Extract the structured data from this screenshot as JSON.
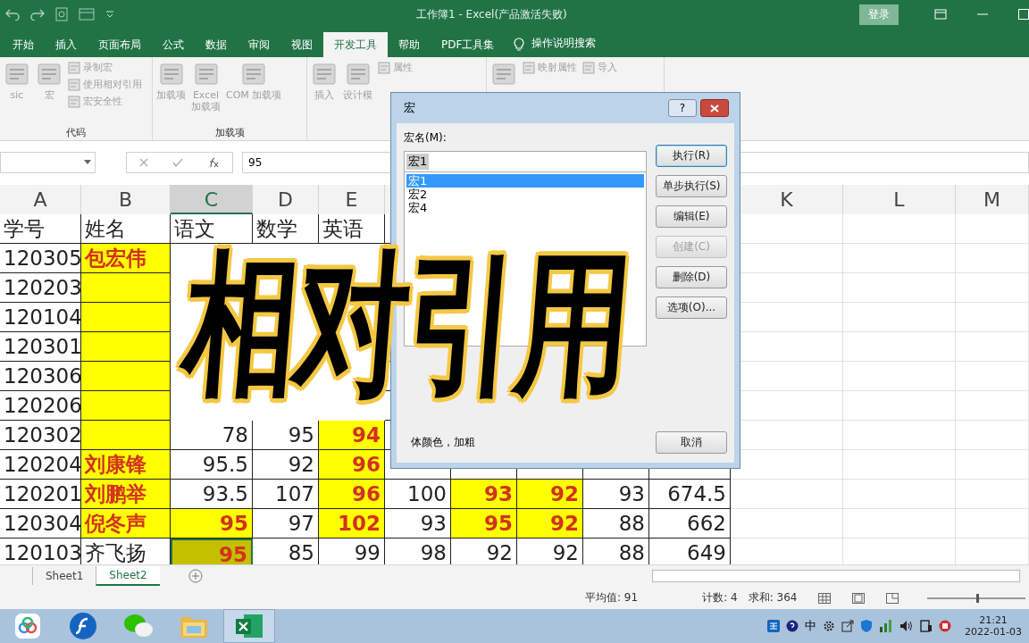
{
  "window": {
    "title": "工作簿1  -  Excel(产品激活失败)",
    "login": "登录"
  },
  "ribbon_tabs": [
    {
      "label": "开始",
      "selected": false
    },
    {
      "label": "插入",
      "selected": false
    },
    {
      "label": "页面布局",
      "selected": false
    },
    {
      "label": "公式",
      "selected": false
    },
    {
      "label": "数据",
      "selected": false
    },
    {
      "label": "审阅",
      "selected": false
    },
    {
      "label": "视图",
      "selected": false
    },
    {
      "label": "开发工具",
      "selected": true
    },
    {
      "label": "帮助",
      "selected": false
    },
    {
      "label": "PDF工具集",
      "selected": false
    }
  ],
  "tell_me": "操作说明搜索",
  "ribbon_groups": [
    {
      "label": "代码",
      "items": [
        {
          "label": "sic",
          "kind": "large"
        },
        {
          "label": "宏",
          "kind": "large"
        },
        {
          "kind": "stack",
          "items": [
            "录制宏",
            "使用相对引用",
            "宏安全性"
          ]
        }
      ]
    },
    {
      "label": "加载项",
      "items": [
        {
          "label": "加载项",
          "kind": "large"
        },
        {
          "label": "Excel\n加载项",
          "kind": "large"
        },
        {
          "label": "COM 加载项",
          "kind": "large"
        }
      ]
    },
    {
      "items": [
        {
          "label": "插入",
          "kind": "large"
        },
        {
          "label": "设计模",
          "kind": "large"
        },
        {
          "kind": "stack",
          "items": [
            "属性"
          ]
        }
      ]
    },
    {
      "items": [
        {
          "kind": "large"
        },
        {
          "kind": "stack",
          "items": [
            "映射属性"
          ]
        },
        {
          "kind": "stack",
          "items": [
            "导入"
          ]
        }
      ]
    }
  ],
  "formula_bar": {
    "value": "95"
  },
  "sheet": {
    "columns": [
      {
        "label": "A",
        "selected": false
      },
      {
        "label": "B",
        "selected": false
      },
      {
        "label": "C",
        "selected": true
      },
      {
        "label": "D",
        "selected": false
      },
      {
        "label": "E",
        "selected": false
      },
      null,
      null,
      null,
      null,
      null,
      {
        "label": "K",
        "selected": false
      },
      {
        "label": "L",
        "selected": false
      },
      {
        "label": "M",
        "selected": false
      }
    ],
    "rows": [
      {
        "cells": [
          {
            "text": "学号",
            "kind": "plain"
          },
          {
            "text": "姓名",
            "kind": "plain"
          },
          {
            "text": "语文",
            "kind": "plain"
          },
          {
            "text": "数学",
            "kind": "plain"
          },
          {
            "text": "英语",
            "kind": "plain"
          }
        ]
      },
      {
        "cells": [
          {
            "text": "120305",
            "kind": "plain"
          },
          {
            "text": "包宏伟",
            "kind": "highlight"
          }
        ]
      },
      {
        "cells": [
          {
            "text": "120203",
            "kind": "plain"
          },
          {
            "kind": "highlight"
          }
        ]
      },
      {
        "cells": [
          {
            "text": "120104",
            "kind": "plain"
          },
          {
            "kind": "highlight"
          }
        ]
      },
      {
        "cells": [
          {
            "text": "120301",
            "kind": "plain"
          },
          {
            "kind": "highlight"
          }
        ]
      },
      {
        "cells": [
          {
            "text": "120306",
            "kind": "plain"
          },
          {
            "kind": "highlight"
          }
        ]
      },
      {
        "cells": [
          {
            "text": "120206",
            "kind": "plain"
          },
          {
            "kind": "highlight"
          }
        ]
      },
      {
        "cells": [
          {
            "text": "120302",
            "kind": "plain"
          },
          {
            "kind": "highlight"
          },
          {
            "text": "78",
            "kind": "plain"
          },
          {
            "text": "95",
            "kind": "plain"
          },
          {
            "text": "94",
            "kind": "highlight"
          }
        ]
      },
      {
        "cells": [
          {
            "text": "120204",
            "kind": "plain"
          },
          {
            "text": "刘康锋",
            "kind": "highlight"
          },
          {
            "text": "95.5",
            "kind": "plain"
          },
          {
            "text": "92",
            "kind": "plain"
          },
          {
            "text": "96",
            "kind": "highlight"
          }
        ]
      },
      {
        "cells": [
          {
            "text": "120201",
            "kind": "plain"
          },
          {
            "text": "刘鹏举",
            "kind": "highlight"
          },
          {
            "text": "93.5",
            "kind": "plain"
          },
          {
            "text": "107",
            "kind": "plain"
          },
          {
            "text": "96",
            "kind": "highlight"
          },
          {
            "text": "100",
            "kind": "plain"
          },
          {
            "text": "93",
            "kind": "highlight"
          },
          {
            "text": "92",
            "kind": "highlight"
          },
          {
            "text": "93",
            "kind": "plain"
          },
          {
            "text": "674.5",
            "kind": "plain"
          }
        ]
      },
      {
        "cells": [
          {
            "text": "120304",
            "kind": "plain"
          },
          {
            "text": "倪冬声",
            "kind": "highlight"
          },
          {
            "text": "95",
            "kind": "highlight"
          },
          {
            "text": "97",
            "kind": "plain"
          },
          {
            "text": "102",
            "kind": "highlight"
          },
          {
            "text": "93",
            "kind": "plain"
          },
          {
            "text": "95",
            "kind": "highlight"
          },
          {
            "text": "92",
            "kind": "highlight"
          },
          {
            "text": "88",
            "kind": "plain"
          },
          {
            "text": "662",
            "kind": "plain"
          }
        ]
      },
      {
        "cells": [
          {
            "text": "120103",
            "kind": "plain"
          },
          {
            "text": "齐飞扬",
            "kind": "plain"
          },
          {
            "text": "95",
            "kind": "active"
          },
          {
            "text": "85",
            "kind": "plain"
          },
          {
            "text": "99",
            "kind": "plain"
          },
          {
            "text": "98",
            "kind": "plain"
          },
          {
            "text": "92",
            "kind": "plain"
          },
          {
            "text": "92",
            "kind": "plain"
          },
          {
            "text": "88",
            "kind": "plain"
          },
          {
            "text": "649",
            "kind": "plain"
          }
        ]
      }
    ]
  },
  "sheet_tabs": [
    {
      "label": "Sheet1",
      "selected": false
    },
    {
      "label": "Sheet2",
      "selected": true
    }
  ],
  "status_bar": {
    "average": "平均值: 91",
    "count": "计数: 4",
    "sum": "求和: 364",
    "zoom": {
      "level": 0.5
    }
  },
  "dialog": {
    "title": "宏",
    "help": "?",
    "name_label": "宏名(M):",
    "name_value": "宏1",
    "macros": [
      {
        "label": "宏1",
        "selected": true
      },
      {
        "label": "宏2",
        "selected": false
      },
      {
        "label": "宏4",
        "selected": false
      }
    ],
    "buttons": [
      {
        "label": "执行(R)",
        "kind": "default",
        "disabled": false
      },
      {
        "label": "单步执行(S)",
        "kind": "normal",
        "disabled": false
      },
      {
        "label": "编辑(E)",
        "kind": "normal",
        "disabled": false
      },
      {
        "label": "创建(C)",
        "kind": "normal",
        "disabled": true
      },
      {
        "label": "删除(D)",
        "kind": "normal",
        "disabled": false
      },
      {
        "label": "选项(O)...",
        "kind": "normal",
        "disabled": false
      }
    ],
    "description": "体颜色，加粗",
    "cancel": "取消"
  },
  "overlay_title": "相对引用",
  "taskbar": {
    "apps": [
      {
        "kind": "cloud",
        "selected": false
      },
      {
        "kind": "flash",
        "selected": false
      },
      {
        "kind": "chat",
        "selected": false
      },
      {
        "kind": "folder",
        "selected": false
      },
      {
        "kind": "excel",
        "selected": true
      }
    ],
    "ime": "中",
    "time": "21:21",
    "date": "2022-01-03"
  }
}
